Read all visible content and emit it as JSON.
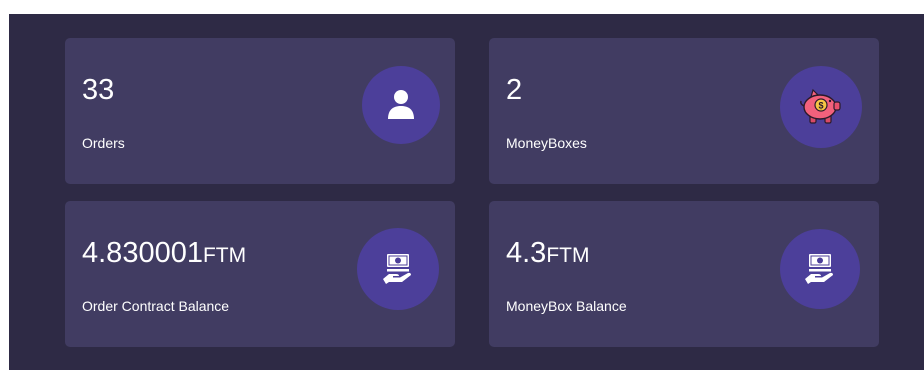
{
  "cards": [
    {
      "value": "33",
      "unit": "",
      "label": "Orders",
      "icon": "user-icon"
    },
    {
      "value": "2",
      "unit": "",
      "label": "MoneyBoxes",
      "icon": "piggy-bank-icon"
    },
    {
      "value": "4.830001",
      "unit": "FTM",
      "label": "Order Contract Balance",
      "icon": "money-hand-icon"
    },
    {
      "value": "4.3",
      "unit": "FTM",
      "label": "MoneyBox Balance",
      "icon": "money-hand-icon"
    }
  ],
  "colors": {
    "background": "#2e2a45",
    "card": "#413c62",
    "icon_circle": "#4c3f9a",
    "piggy": "#f2617c"
  }
}
